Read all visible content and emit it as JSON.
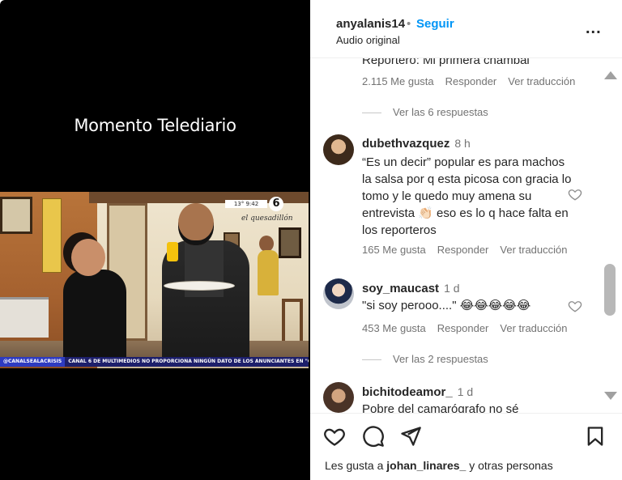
{
  "video": {
    "caption": "Momento Telediario",
    "logo_text": "13° 9:42",
    "channel_number": "6",
    "restaurant_sign": "el quesadillón",
    "ticker_tag": "@CANALSEALACRISIS",
    "ticker_text": "CANAL 6 DE MULTIMEDIOS NO PROPORCIONA NINGÚN DATO DE LOS ANUNCIANTES EN \"GANALE A"
  },
  "header": {
    "username": "anyalanis14",
    "separator": "•",
    "follow_label": "Seguir",
    "audio_label": "Audio original",
    "more_label": "..."
  },
  "comments": {
    "cut_off_text": "Reportero: Mi primera chambal",
    "first_meta": {
      "likes": "2.115 Me gusta",
      "reply": "Responder",
      "translate": "Ver traducción"
    },
    "first_replies": "Ver las 6 respuestas",
    "items": [
      {
        "user": "dubethvazquez",
        "time": "8 h",
        "text": "“Es un decir” popular es para machos la salsa por q esta picosa con gracia lo tomo y le quedo muy amena su entrevista 👏🏻 eso es lo q hace falta en los reporteros",
        "likes": "165 Me gusta",
        "reply": "Responder",
        "translate": "Ver traducción"
      },
      {
        "user": "soy_maucast",
        "time": "1 d",
        "text": "\"si soy perooo....\" 😂😂😂😂😂",
        "likes": "453 Me gusta",
        "reply": "Responder",
        "translate": "Ver traducción",
        "replies": "Ver las 2 respuestas"
      },
      {
        "user": "bichitodeamor_",
        "time": "1 d",
        "text": "Pobre del camarógrafo no sé"
      }
    ]
  },
  "actions": {
    "likes_prefix": "Les gusta a",
    "likes_user": "johan_linares_",
    "likes_suffix": "y otras personas"
  },
  "colors": {
    "accent": "#0095f6",
    "muted": "#737373",
    "text": "#262626"
  }
}
